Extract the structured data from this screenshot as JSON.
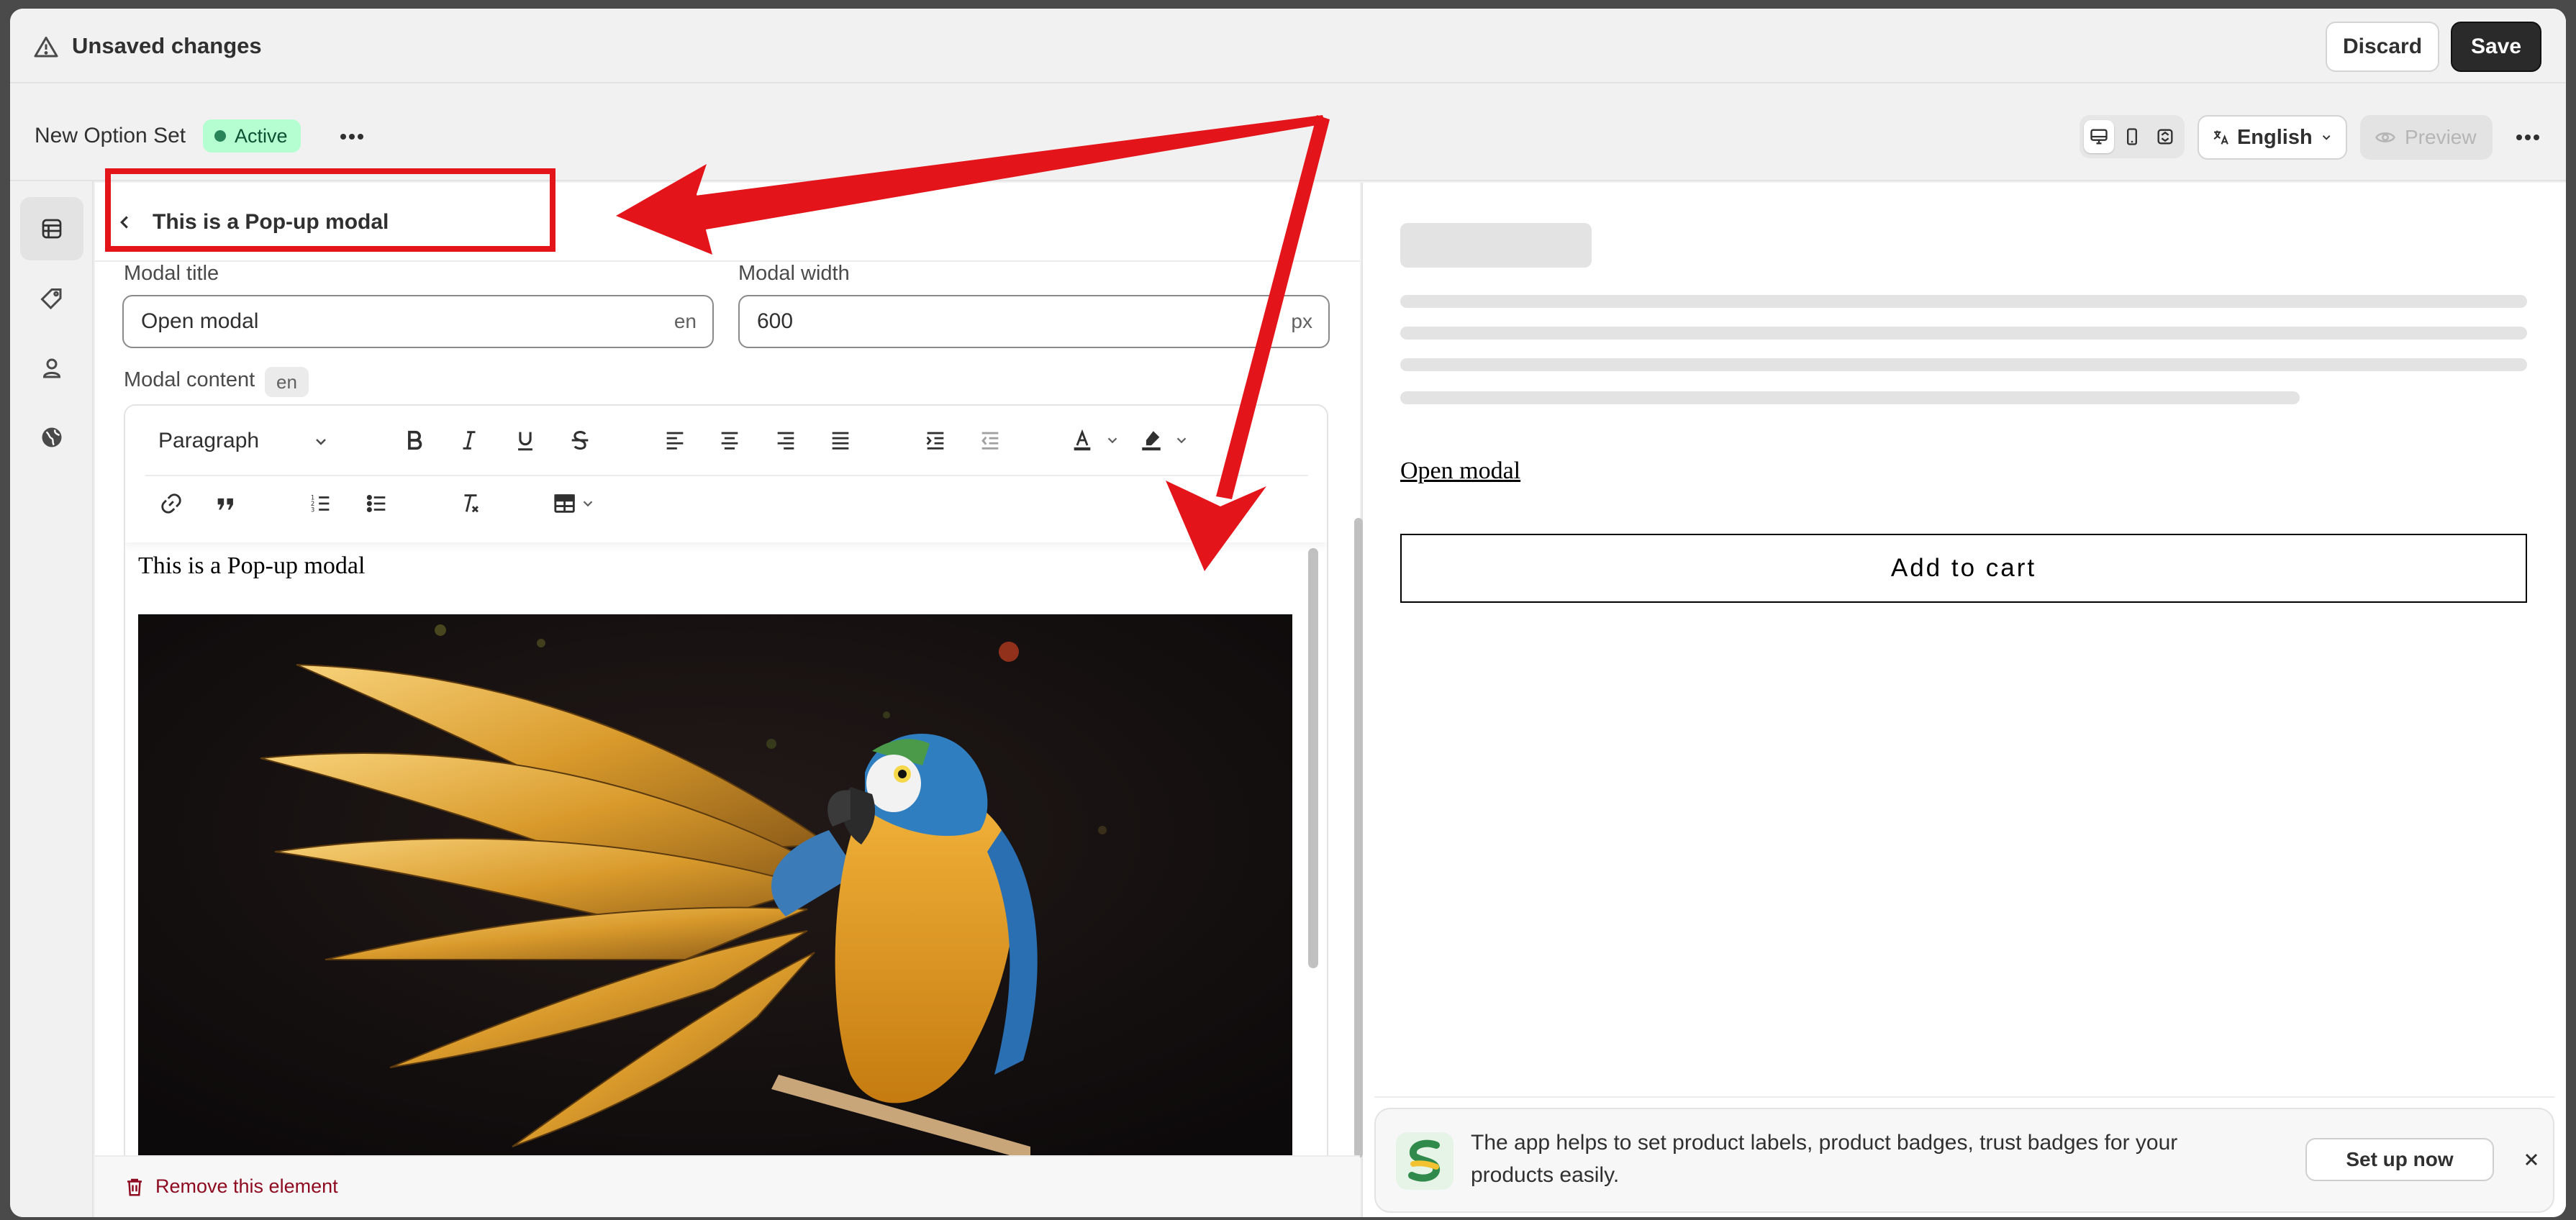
{
  "savebar": {
    "title": "Unsaved changes",
    "discard_label": "Discard",
    "save_label": "Save",
    "icon": "alert-triangle-icon"
  },
  "header": {
    "option_set_name": "New Option Set",
    "status_badge": "Active",
    "language": "English",
    "preview_label": "Preview",
    "device_icons": [
      "desktop-icon",
      "mobile-icon",
      "fullscreen-icon"
    ]
  },
  "sidebar": {
    "items": [
      {
        "icon": "list-icon",
        "active": true
      },
      {
        "icon": "tag-icon",
        "active": false
      },
      {
        "icon": "person-icon",
        "active": false
      },
      {
        "icon": "globe-icon",
        "active": false
      }
    ]
  },
  "editor": {
    "title": "This is a Pop-up modal",
    "modal_title_label": "Modal title",
    "modal_title_value": "Open modal",
    "modal_title_suffix": "en",
    "modal_width_label": "Modal width",
    "modal_width_value": "600",
    "modal_width_suffix": "px",
    "modal_content_label": "Modal content",
    "modal_content_lang": "en",
    "toolbar": {
      "block_format": "Paragraph",
      "tools": [
        "bold-icon",
        "italic-icon",
        "underline-icon",
        "strikethrough-icon",
        "align-left-icon",
        "align-center-icon",
        "align-right-icon",
        "align-justify-icon",
        "indent-icon",
        "outdent-icon",
        "text-color-icon",
        "highlight-icon",
        "link-icon",
        "blockquote-icon",
        "ordered-list-icon",
        "bullet-list-icon",
        "clear-format-icon",
        "table-icon"
      ]
    },
    "content_text": "This is a Pop-up modal",
    "content_image": "parrot-image",
    "remove_label": "Remove this element"
  },
  "preview": {
    "link_text": "Open modal",
    "add_to_cart_label": "Add to cart"
  },
  "banner": {
    "text": "The app helps to set product labels, product badges, trust badges for your products easily.",
    "button_label": "Set up now"
  },
  "colors": {
    "annotation": "#e3151b",
    "active_badge_bg": "#b4fed2",
    "active_badge_text": "#0c5132",
    "danger": "#8e0b21"
  }
}
